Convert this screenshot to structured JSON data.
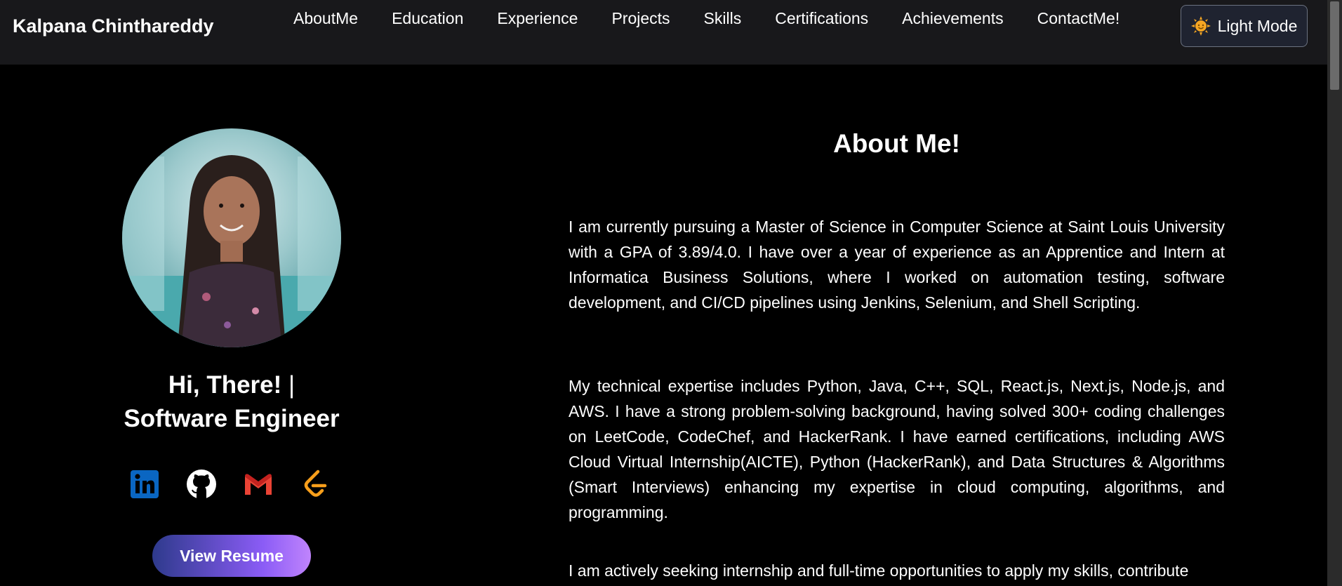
{
  "navbar": {
    "brand": "Kalpana Chinthareddy",
    "links": [
      "AboutMe",
      "Education",
      "Experience",
      "Projects",
      "Skills",
      "Certifications",
      "Achievements",
      "ContactMe!"
    ],
    "theme_toggle_label": "Light Mode",
    "theme_icon": "sun-icon"
  },
  "profile": {
    "greeting": "Hi, There!",
    "cursor": "|",
    "role": "Software Engineer",
    "socials": [
      {
        "name": "linkedin-icon",
        "color": "#0a66c2"
      },
      {
        "name": "github-icon",
        "color": "#ffffff"
      },
      {
        "name": "gmail-icon",
        "color": "#ea4335"
      },
      {
        "name": "leetcode-icon",
        "color": "#f89f1b"
      }
    ],
    "resume_label": "View Resume"
  },
  "about": {
    "title": "About Me!",
    "paragraphs": [
      "I am currently pursuing a Master of Science in Computer Science at Saint Louis University with a GPA of 3.89/4.0. I have over a year of experience as an Apprentice and Intern at Informatica Business Solutions, where I worked on automation testing, software development, and CI/CD pipelines using Jenkins, Selenium, and Shell Scripting.",
      "My technical expertise includes Python, Java, C++, SQL, React.js, Next.js, Node.js, and AWS. I have a strong problem-solving background, having solved 300+ coding challenges on LeetCode, CodeChef, and HackerRank. I have earned certifications, including AWS Cloud Virtual Internship(AICTE), Python (HackerRank), and Data Structures & Algorithms (Smart Interviews) enhancing my expertise in cloud computing, algorithms, and programming.",
      "I am actively seeking internship and full-time opportunities to apply my skills, contribute"
    ]
  },
  "colors": {
    "background": "#000000",
    "navbar_bg": "#18181b",
    "toggle_bg": "#1f2330",
    "resume_gradient_start": "#2e3a8c",
    "resume_gradient_end": "#c084fc"
  }
}
